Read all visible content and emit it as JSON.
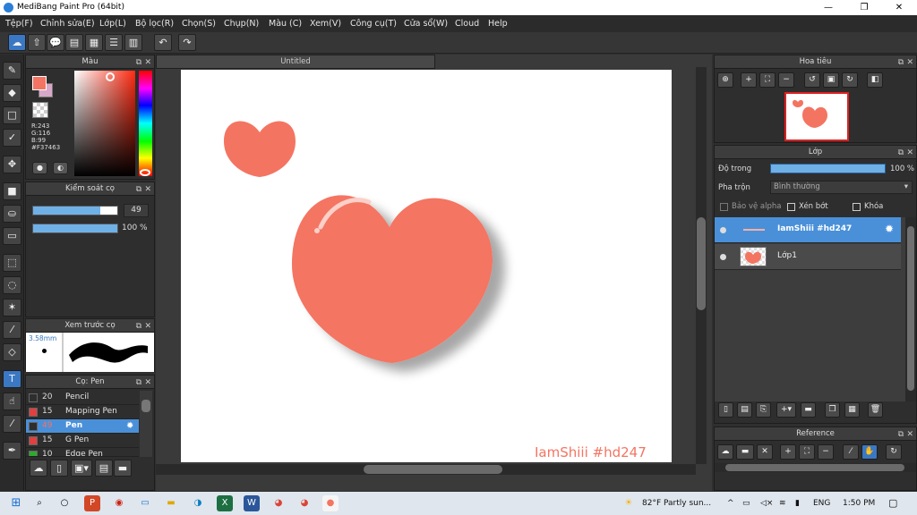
{
  "window": {
    "title": "MediBang Paint Pro (64bit)",
    "minimize": "—",
    "maximize": "❐",
    "close": "✕"
  },
  "menu": [
    "Tệp(F)",
    "Chỉnh sửa(E)",
    "Lớp(L)",
    "Bộ lọc(R)",
    "Chọn(S)",
    "Chụp(N)",
    "Màu (C)",
    "Xem(V)",
    "Công cụ(T)",
    "Cửa sổ(W)",
    "Cloud",
    "Help"
  ],
  "color_panel": {
    "title": "Màu",
    "r": "R:243",
    "g": "G:116",
    "b": "B:99",
    "hex": "#F37463",
    "fg_color": "#F37463"
  },
  "brush_control": {
    "title": "Kiểm soát cọ",
    "size_value": "49",
    "opacity_value": "100 %",
    "size_fraction": 0.8,
    "opacity_fraction": 1.0
  },
  "brush_preview": {
    "title": "Xem trước cọ",
    "size": "3.58mm"
  },
  "brush_list": {
    "title": "Cọ: Pen",
    "items": [
      {
        "size": "20",
        "name": "Pencil",
        "color": "#2e2e2e"
      },
      {
        "size": "15",
        "name": "Mapping Pen",
        "color": "#e04040"
      },
      {
        "size": "49",
        "name": "Pen",
        "color": "#2e2e2e"
      },
      {
        "size": "15",
        "name": "G Pen",
        "color": "#e04040"
      },
      {
        "size": "10",
        "name": "Edge Pen",
        "color": "#2eaa2e"
      }
    ]
  },
  "canvas": {
    "doc_title": "Untitled",
    "watermark": "IamShiii #hd247"
  },
  "navigator": {
    "title": "Hoa tiêu"
  },
  "layers": {
    "title": "Lớp",
    "opacity_label": "Độ trong",
    "opacity_value": "100 %",
    "blend_label": "Pha trộn",
    "blend_value": "Bình thường",
    "protect_alpha": "Bảo vệ alpha",
    "clipping": "Xén bớt",
    "lock": "Khóa",
    "items": [
      {
        "name": "IamShiii #hd247"
      },
      {
        "name": "Lớp1"
      }
    ]
  },
  "reference": {
    "title": "Reference"
  },
  "taskbar": {
    "weather": "82°F  Partly sun...",
    "language": "ENG",
    "time": "1:50 PM"
  }
}
